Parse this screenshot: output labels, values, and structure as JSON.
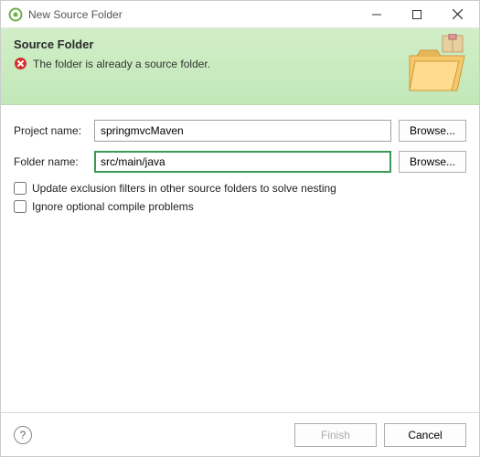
{
  "window": {
    "title": "New Source Folder"
  },
  "header": {
    "title": "Source Folder",
    "status_message": "The folder is already a source folder."
  },
  "form": {
    "project_label": "Project name:",
    "project_value": "springmvcMaven",
    "folder_label": "Folder name:",
    "folder_value": "src/main/java",
    "browse_label": "Browse...",
    "check1_label": "Update exclusion filters in other source folders to solve nesting",
    "check2_label": "Ignore optional compile problems"
  },
  "footer": {
    "finish_label": "Finish",
    "cancel_label": "Cancel"
  }
}
